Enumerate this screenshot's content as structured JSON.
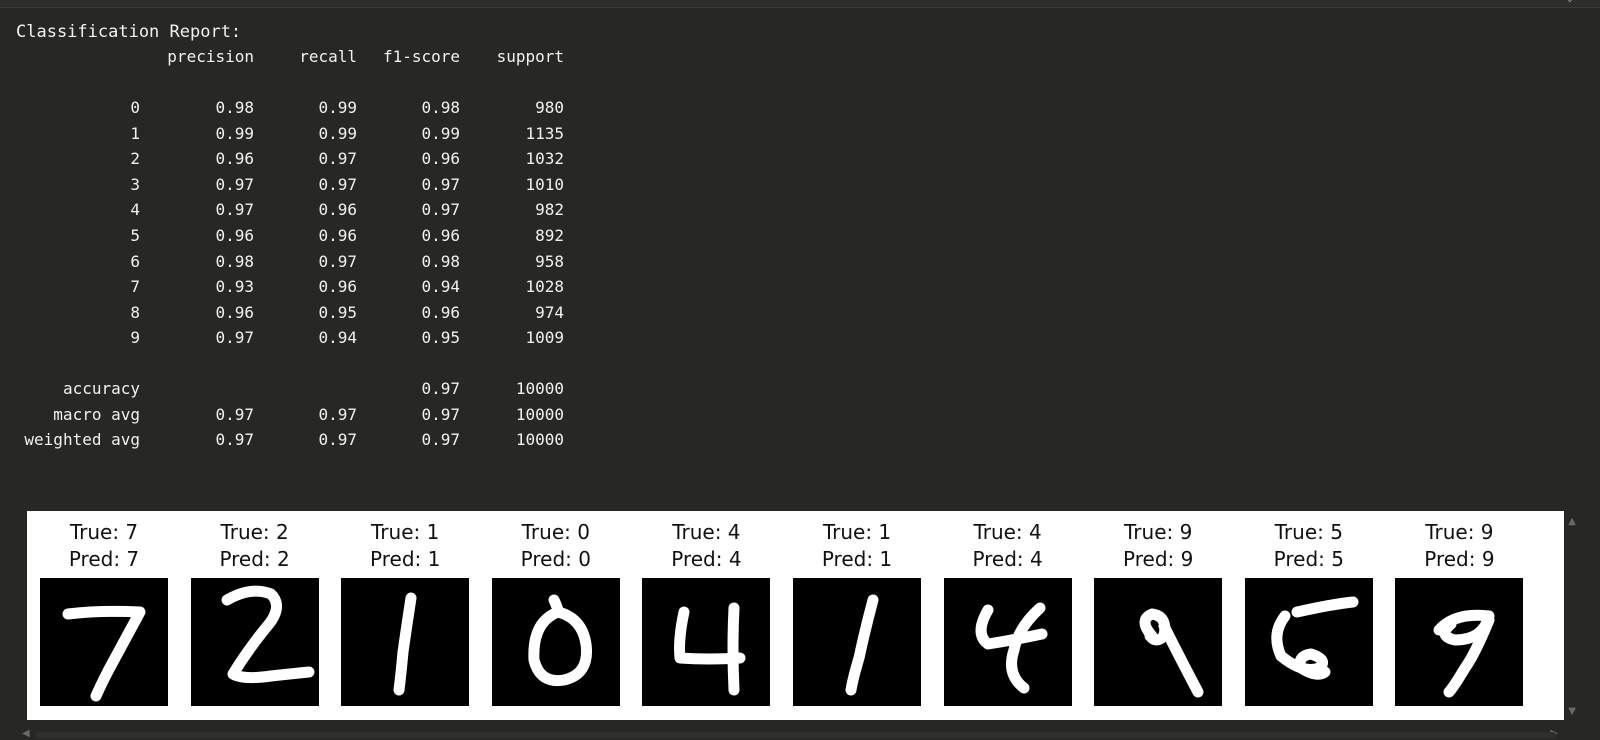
{
  "report": {
    "title": "Classification Report:",
    "headers": [
      "precision",
      "recall",
      "f1-score",
      "support"
    ],
    "rows": [
      {
        "label": "0",
        "precision": "0.98",
        "recall": "0.99",
        "f1": "0.98",
        "support": "980"
      },
      {
        "label": "1",
        "precision": "0.99",
        "recall": "0.99",
        "f1": "0.99",
        "support": "1135"
      },
      {
        "label": "2",
        "precision": "0.96",
        "recall": "0.97",
        "f1": "0.96",
        "support": "1032"
      },
      {
        "label": "3",
        "precision": "0.97",
        "recall": "0.97",
        "f1": "0.97",
        "support": "1010"
      },
      {
        "label": "4",
        "precision": "0.97",
        "recall": "0.96",
        "f1": "0.97",
        "support": "982"
      },
      {
        "label": "5",
        "precision": "0.96",
        "recall": "0.96",
        "f1": "0.96",
        "support": "892"
      },
      {
        "label": "6",
        "precision": "0.98",
        "recall": "0.97",
        "f1": "0.98",
        "support": "958"
      },
      {
        "label": "7",
        "precision": "0.93",
        "recall": "0.96",
        "f1": "0.94",
        "support": "1028"
      },
      {
        "label": "8",
        "precision": "0.96",
        "recall": "0.95",
        "f1": "0.96",
        "support": "974"
      },
      {
        "label": "9",
        "precision": "0.97",
        "recall": "0.94",
        "f1": "0.95",
        "support": "1009"
      }
    ],
    "summary": [
      {
        "label": "accuracy",
        "precision": "",
        "recall": "",
        "f1": "0.97",
        "support": "10000"
      },
      {
        "label": "macro avg",
        "precision": "0.97",
        "recall": "0.97",
        "f1": "0.97",
        "support": "10000"
      },
      {
        "label": "weighted avg",
        "precision": "0.97",
        "recall": "0.97",
        "f1": "0.97",
        "support": "10000"
      }
    ]
  },
  "samples": [
    {
      "true_label": "True: 7",
      "pred_label": "Pred: 7",
      "digit": "7"
    },
    {
      "true_label": "True: 2",
      "pred_label": "Pred: 2",
      "digit": "2"
    },
    {
      "true_label": "True: 1",
      "pred_label": "Pred: 1",
      "digit": "1"
    },
    {
      "true_label": "True: 0",
      "pred_label": "Pred: 0",
      "digit": "0"
    },
    {
      "true_label": "True: 4",
      "pred_label": "Pred: 4",
      "digit": "4"
    },
    {
      "true_label": "True: 1",
      "pred_label": "Pred: 1",
      "digit": "1b"
    },
    {
      "true_label": "True: 4",
      "pred_label": "Pred: 4",
      "digit": "4b"
    },
    {
      "true_label": "True: 9",
      "pred_label": "Pred: 9",
      "digit": "9"
    },
    {
      "true_label": "True: 5",
      "pred_label": "Pred: 5",
      "digit": "5"
    },
    {
      "true_label": "True: 9",
      "pred_label": "Pred: 9",
      "digit": "9b"
    }
  ],
  "icons": {
    "scroll_up": "chevron-up-icon",
    "scroll_down": "chevron-down-icon",
    "scroll_left": "chevron-left-icon",
    "scroll_right": "chevron-right-icon"
  },
  "colors": {
    "background": "#272723",
    "text": "#f2f2ee",
    "figure_bg": "#ffffff",
    "image_bg": "#000000",
    "stroke": "#ffffff"
  }
}
